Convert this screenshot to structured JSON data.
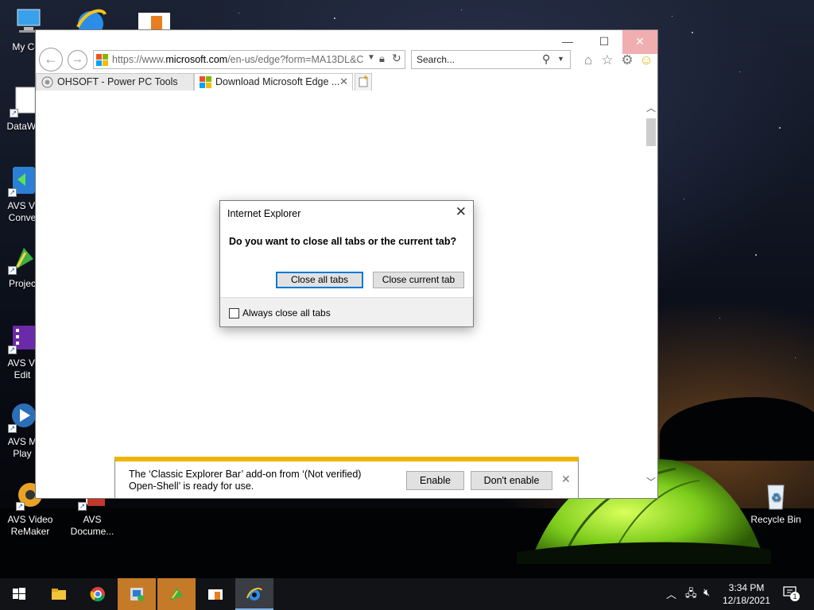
{
  "desktop": {
    "icons": [
      {
        "label": "My Con",
        "icon": "computer-icon"
      },
      {
        "label": "DataWa",
        "icon": "file-icon"
      },
      {
        "label": "AVS Vi\nConve",
        "icon": "avs-video-converter-icon"
      },
      {
        "label": "Projec",
        "icon": "project-icon"
      },
      {
        "label": "AVS Vi\nEdit",
        "icon": "avs-video-editor-icon"
      },
      {
        "label": "AVS M\nPlay",
        "icon": "avs-media-player-icon"
      },
      {
        "label": "AVS Video\nReMaker",
        "icon": "avs-video-remaker-icon"
      },
      {
        "label": "AVS\nDocume...",
        "icon": "avs-document-converter-icon"
      },
      {
        "label": "Recycle Bin",
        "icon": "recycle-bin-icon"
      }
    ]
  },
  "browser": {
    "address": {
      "prefix": "https://www.",
      "domain": "microsoft.com",
      "path": "/en-us/edge?form=MA13DL&C"
    },
    "search_placeholder": "Search...",
    "tabs": [
      {
        "label": "OHSOFT - Power PC Tools",
        "icon": "ohsoft-icon",
        "active": false
      },
      {
        "label": "Download Microsoft Edge ...",
        "icon": "microsoft-logo-icon",
        "active": true
      }
    ],
    "window_controls": {
      "minimize": "—",
      "maximize": "☐",
      "close": "✕"
    }
  },
  "dialog": {
    "title": "Internet Explorer",
    "question": "Do you want to close all tabs or the current tab?",
    "close_all_label": "Close all tabs",
    "close_current_label": "Close current tab",
    "checkbox_label": "Always close all tabs",
    "checkbox_checked": false
  },
  "notification": {
    "line1": "The ‘Classic Explorer Bar’ add-on from ‘(Not verified)",
    "line2": "Open-Shell’ is ready for use.",
    "enable_label": "Enable",
    "dont_enable_label": "Don't enable",
    "accent": "#f0b400"
  },
  "taskbar": {
    "apps": [
      "start-icon",
      "file-explorer-icon",
      "chrome-icon",
      "system-tool-icon",
      "project-app-icon",
      "office-app-icon",
      "internet-explorer-icon"
    ],
    "time": "3:34 PM",
    "date": "12/18/2021",
    "notification_count": "1"
  }
}
